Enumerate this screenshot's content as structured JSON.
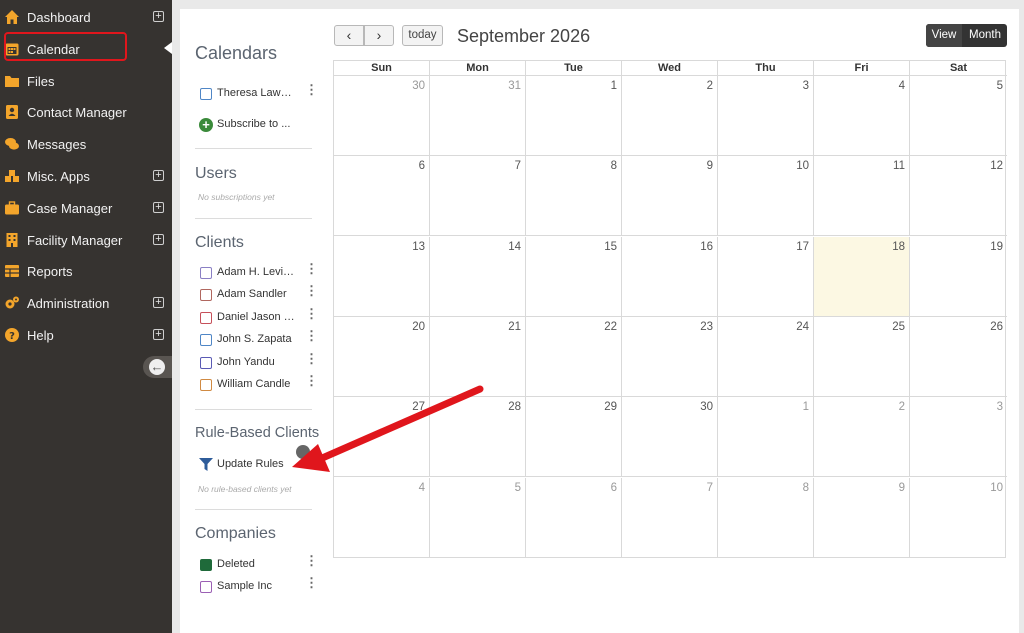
{
  "nav": {
    "items": [
      {
        "label": "Dashboard",
        "icon": "home-icon",
        "expandable": true
      },
      {
        "label": "Calendar",
        "icon": "calendar-icon",
        "expandable": false
      },
      {
        "label": "Files",
        "icon": "folder-icon",
        "expandable": false
      },
      {
        "label": "Contact Manager",
        "icon": "contact-card-icon",
        "expandable": false
      },
      {
        "label": "Messages",
        "icon": "chat-bubbles-icon",
        "expandable": false
      },
      {
        "label": "Misc. Apps",
        "icon": "cubes-icon",
        "expandable": true
      },
      {
        "label": "Case Manager",
        "icon": "briefcase-icon",
        "expandable": true
      },
      {
        "label": "Facility Manager",
        "icon": "building-icon",
        "expandable": true
      },
      {
        "label": "Reports",
        "icon": "table-icon",
        "expandable": false
      },
      {
        "label": "Administration",
        "icon": "gears-icon",
        "expandable": true
      },
      {
        "label": "Help",
        "icon": "question-circle-icon",
        "expandable": true
      }
    ],
    "active": "Calendar",
    "plus_glyph": "+",
    "collapse_glyph": "←"
  },
  "panel": {
    "calendars_title": "Calendars",
    "my_calendar": "Theresa Lawrence",
    "subscribe_label": "Subscribe to ...",
    "users_title": "Users",
    "users_empty": "No subscriptions yet",
    "clients_title": "Clients",
    "clients": [
      {
        "name": "Adam H. Levine",
        "color": "#8a7fc4"
      },
      {
        "name": "Adam Sandler",
        "color": "#b0675f"
      },
      {
        "name": "Daniel Jason Smith",
        "color": "#c6505a"
      },
      {
        "name": "John S. Zapata",
        "color": "#4f86c6"
      },
      {
        "name": "John Yandu",
        "color": "#5a5ab4"
      },
      {
        "name": "William Candle",
        "color": "#d08a42"
      }
    ],
    "rule_title": "Rule-Based Clients",
    "update_rules": "Update Rules",
    "rule_empty": "No rule-based clients yet",
    "companies_title": "Companies",
    "companies": [
      {
        "name": "Deleted",
        "color": "#1f6a3a",
        "filled": true
      },
      {
        "name": "Sample Inc",
        "color": "#9b5fb4",
        "filled": false
      }
    ],
    "kebab": "⋮"
  },
  "toolbar": {
    "prev": "‹",
    "next": "›",
    "today": "today",
    "title": "September 2026",
    "view_label": "View",
    "month_label": "Month"
  },
  "calendar": {
    "weekdays": [
      "Sun",
      "Mon",
      "Tue",
      "Wed",
      "Thu",
      "Fri",
      "Sat"
    ],
    "weeks": [
      [
        {
          "d": "30",
          "o": true
        },
        {
          "d": "31",
          "o": true
        },
        {
          "d": "1"
        },
        {
          "d": "2"
        },
        {
          "d": "3"
        },
        {
          "d": "4"
        },
        {
          "d": "5"
        }
      ],
      [
        {
          "d": "6"
        },
        {
          "d": "7"
        },
        {
          "d": "8"
        },
        {
          "d": "9"
        },
        {
          "d": "10"
        },
        {
          "d": "11"
        },
        {
          "d": "12"
        }
      ],
      [
        {
          "d": "13"
        },
        {
          "d": "14"
        },
        {
          "d": "15"
        },
        {
          "d": "16"
        },
        {
          "d": "17"
        },
        {
          "d": "18",
          "today": true
        },
        {
          "d": "19"
        }
      ],
      [
        {
          "d": "20"
        },
        {
          "d": "21"
        },
        {
          "d": "22"
        },
        {
          "d": "23"
        },
        {
          "d": "24"
        },
        {
          "d": "25"
        },
        {
          "d": "26"
        }
      ],
      [
        {
          "d": "27"
        },
        {
          "d": "28"
        },
        {
          "d": "29"
        },
        {
          "d": "30"
        },
        {
          "d": "1",
          "o": true
        },
        {
          "d": "2",
          "o": true
        },
        {
          "d": "3",
          "o": true
        }
      ],
      [
        {
          "d": "4",
          "o": true
        },
        {
          "d": "5",
          "o": true
        },
        {
          "d": "6",
          "o": true
        },
        {
          "d": "7",
          "o": true
        },
        {
          "d": "8",
          "o": true
        },
        {
          "d": "9",
          "o": true
        },
        {
          "d": "10",
          "o": true
        }
      ]
    ]
  },
  "colors": {
    "accent_green": "#3a8a3a",
    "today_bg": "#fcf8e3",
    "annotation_red": "#e0161c",
    "filter_blue": "#2e5c9a"
  }
}
